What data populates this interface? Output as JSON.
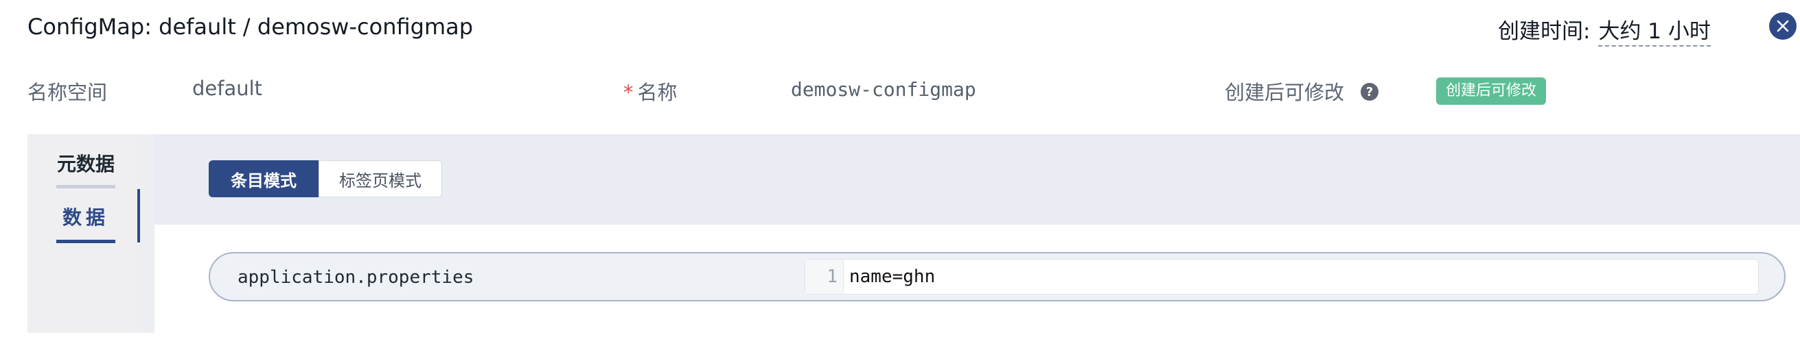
{
  "header": {
    "title": "ConfigMap: default / demosw-configmap",
    "created_label": "创建时间:",
    "created_value": "大约 1 小时",
    "close_icon": "close-icon"
  },
  "meta": {
    "namespace_label": "名称空间",
    "namespace_value": "default",
    "name_required_mark": "*",
    "name_label": "名称",
    "name_value": "demosw-configmap",
    "mutable_label": "创建后可修改",
    "help_icon_text": "?",
    "mutable_tag": "创建后可修改"
  },
  "side_tabs": [
    {
      "label": "元数据",
      "active": false
    },
    {
      "label": "数据",
      "active": true
    }
  ],
  "mode_toggle": {
    "items": [
      "条目模式",
      "标签页模式"
    ],
    "selected": "条目模式"
  },
  "data_entries": [
    {
      "key": "application.properties",
      "line_number": "1",
      "value": "name=ghn"
    }
  ],
  "colors": {
    "accent": "#2e4a86",
    "tag_green": "#5cbf95",
    "required": "#e24a4a"
  }
}
